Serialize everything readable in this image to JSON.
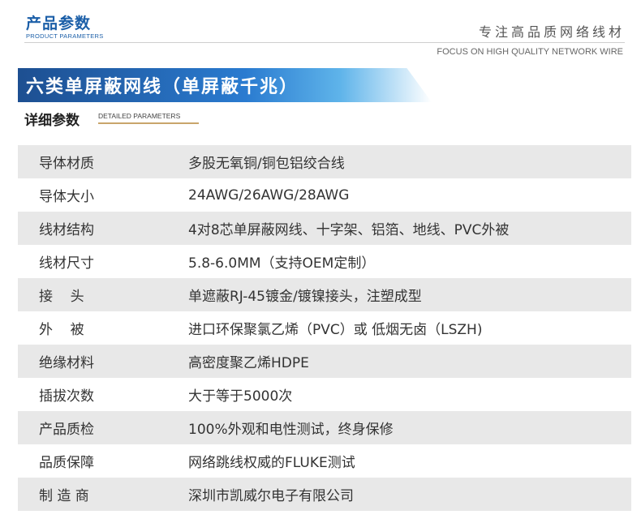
{
  "header": {
    "title": "产品参数",
    "subtitle": "PRODUCT PARAMETERS",
    "slogan": "专注高品质网络线材",
    "slogan_en": "FOCUS ON HIGH QUALITY NETWORK WIRE"
  },
  "banner": {
    "text": "六类单屏蔽网线（单屏蔽千兆）"
  },
  "section": {
    "title": "详细参数",
    "title_en": "DETAILED PARAMETERS"
  },
  "colors": {
    "brand_blue": "#1c5fa8",
    "banner_dark": "#1d4f91",
    "row_shade": "#e8e8e8",
    "accent_gold": "#c9a56b"
  },
  "rows": [
    {
      "label": "导体材质",
      "value": "多股无氧铜/铜包铝绞合线"
    },
    {
      "label": "导体大小",
      "value": "24AWG/26AWG/28AWG"
    },
    {
      "label": "线材结构",
      "value": "4对8芯单屏蔽网线、十字架、铝箔、地线、PVC外被"
    },
    {
      "label": "线材尺寸",
      "value": "5.8-6.0MM（支持OEM定制）"
    },
    {
      "label": "接    头",
      "value": "单遮蔽RJ-45镀金/镀镍接头，注塑成型"
    },
    {
      "label": "外    被",
      "value": "进口环保聚氯乙烯（PVC）或 低烟无卤（LSZH)"
    },
    {
      "label": "绝缘材料",
      "value": "高密度聚乙烯HDPE"
    },
    {
      "label": "插拔次数",
      "value": "大于等于5000次"
    },
    {
      "label": "产品质检",
      "value": "100%外观和电性测试，终身保修"
    },
    {
      "label": "品质保障",
      "value": "网络跳线权威的FLUKE测试"
    },
    {
      "label": "制 造 商",
      "value": "深圳市凯威尔电子有限公司"
    }
  ]
}
